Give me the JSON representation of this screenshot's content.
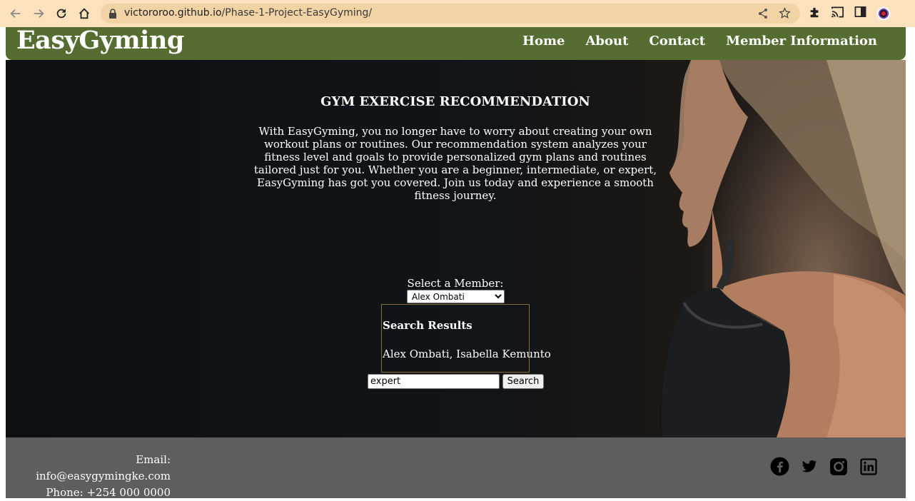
{
  "browser": {
    "url_host": "victororoo.github.io",
    "url_path": "/Phase-1-Project-EasyGyming/",
    "colors": {
      "chrome": "#fbe2bd",
      "omnibox": "#f1d3a6"
    }
  },
  "site": {
    "logo": "EasyGyming",
    "nav": {
      "home": "Home",
      "about": "About",
      "contact": "Contact",
      "member_info": "Member Information"
    },
    "colors": {
      "header": "#566d31",
      "footer": "#5e5d5f"
    }
  },
  "hero": {
    "title": "GYM EXERCISE RECOMMENDATION",
    "description": "With EasyGyming, you no longer have to worry about creating your own workout plans or routines. Our recommendation system analyzes your fitness level and goals to provide personalized gym plans and routines tailored just for you. Whether you are a beginner, intermediate, or expert, EasyGyming has got you covered. Join us today and experience a smooth fitness journey."
  },
  "member": {
    "label": "Select a Member:",
    "selected": "Alex Ombati"
  },
  "results": {
    "heading": "Search Results",
    "names": "Alex Ombati, Isabella Kemunto"
  },
  "search": {
    "value": "expert",
    "button": "Search"
  },
  "footer": {
    "email": "Email: info@easygymingke.com",
    "phone": "Phone: +254 000 0000",
    "social_icons": [
      "facebook-icon",
      "twitter-icon",
      "instagram-icon",
      "linkedin-icon"
    ]
  }
}
